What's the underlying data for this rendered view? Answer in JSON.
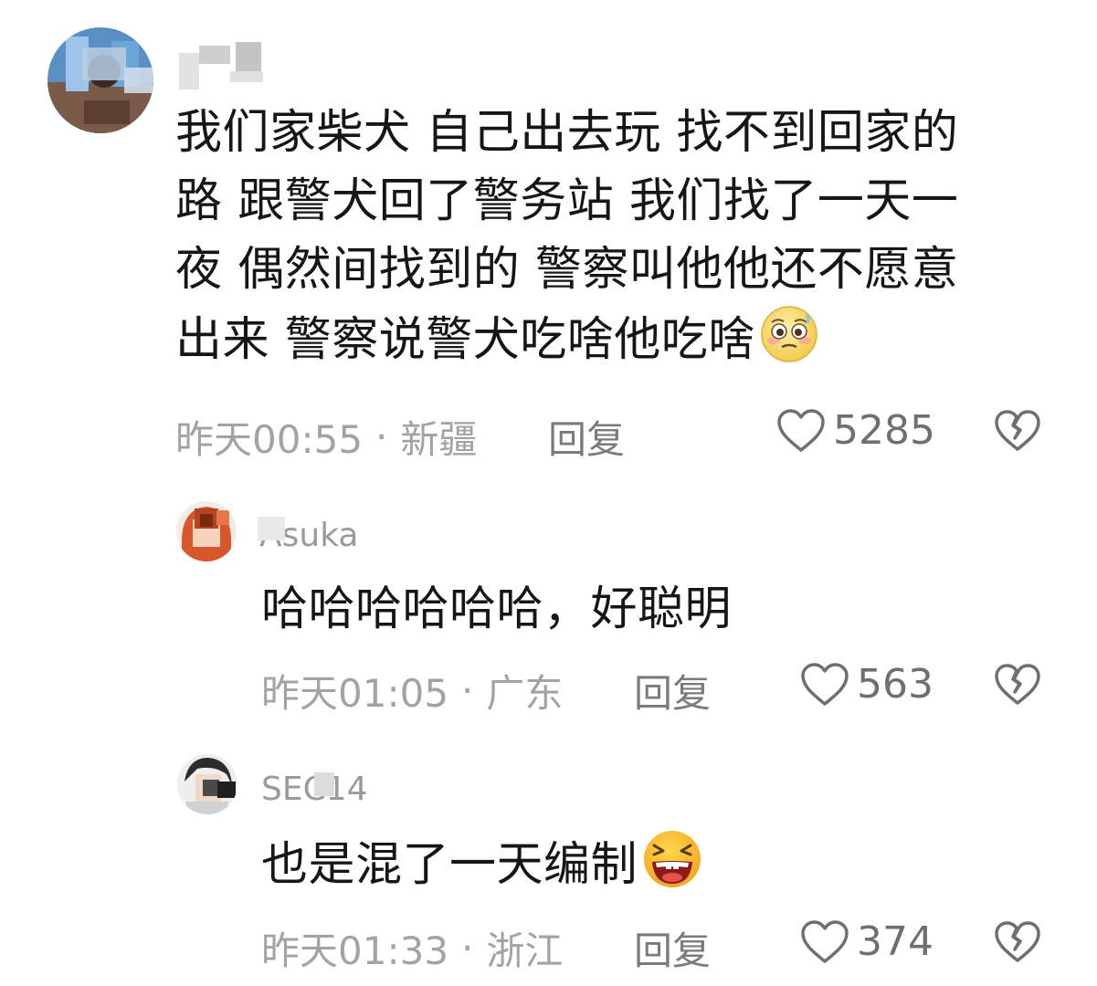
{
  "comments": [
    {
      "username": "",
      "text_lines": [
        "我们家柴犬 自己出去玩 找不到回家的",
        "路 跟警犬回了警务站 我们找了一天一",
        "夜 偶然间找到的 警察叫他他还不愿意",
        "出来 警察说警犬吃啥他吃啥"
      ],
      "emoji": "pleading-face-emoji",
      "time": "昨天00:55",
      "separator": "·",
      "location": "新疆",
      "reply_label": "回复",
      "likes": "5285"
    },
    {
      "username": "Asuka",
      "text_lines": [
        "哈哈哈哈哈哈，好聪明"
      ],
      "emoji": "",
      "time": "昨天01:05",
      "separator": "·",
      "location": "广东",
      "reply_label": "回复",
      "likes": "563"
    },
    {
      "username": "SEC14",
      "text_lines": [
        "也是混了一天编制"
      ],
      "emoji": "laughing-face-emoji",
      "time": "昨天01:33",
      "separator": "·",
      "location": "浙江",
      "reply_label": "回复",
      "likes": "374"
    }
  ],
  "icons": {
    "like": "heart-outline-icon",
    "dislike": "broken-heart-icon"
  },
  "colors": {
    "text": "#161616",
    "meta": "#a3a3a3",
    "reply": "#7b7b7b",
    "icon": "#6f6f6f"
  }
}
